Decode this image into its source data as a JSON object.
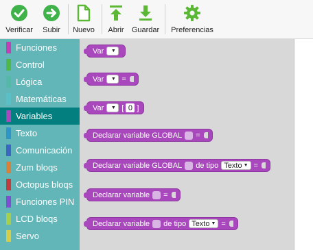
{
  "toolbar": {
    "verify": {
      "label": "Verificar",
      "color": "#3fb24a"
    },
    "upload": {
      "label": "Subir",
      "color": "#3fb24a"
    },
    "new_file": {
      "label": "Nuevo",
      "color": "#5bb834"
    },
    "open": {
      "label": "Abrir",
      "color": "#5bb834"
    },
    "save": {
      "label": "Guardar",
      "color": "#5bb834"
    },
    "prefs": {
      "label": "Preferencias",
      "color": "#5bb834"
    }
  },
  "sidebar": {
    "background": "#63b6b8",
    "selected_background": "#047f7f",
    "categories": [
      {
        "label": "Funciones",
        "color": "#c33fb6"
      },
      {
        "label": "Control",
        "color": "#4fb848"
      },
      {
        "label": "Lógica",
        "color": "#55b9a8"
      },
      {
        "label": "Matemáticas",
        "color": "#58c1c7"
      },
      {
        "label": "Variables",
        "color": "#a848bc",
        "selected": true
      },
      {
        "label": "Texto",
        "color": "#2f94c9"
      },
      {
        "label": "Comunicación",
        "color": "#3b67c2"
      },
      {
        "label": "Zum bloqs",
        "color": "#d7813b"
      },
      {
        "label": "Octopus bloqs",
        "color": "#c43b3b"
      },
      {
        "label": "Funciones PIN",
        "color": "#7f4fd1"
      },
      {
        "label": "LCD bloqs",
        "color": "#a6ce4a"
      },
      {
        "label": "Servo",
        "color": "#d6cc45"
      }
    ]
  },
  "blocks": {
    "b1": {
      "label": "Var"
    },
    "b2": {
      "label": "Var",
      "eq": "="
    },
    "b3": {
      "label": "Var",
      "open_bracket": "[",
      "index": "0",
      "close_bracket": "]"
    },
    "b4": {
      "label": "Declarar variable GLOBAL",
      "eq": "="
    },
    "b5": {
      "label": "Declarar variable GLOBAL",
      "type_label": "de tipo",
      "type_value": "Texto",
      "eq": "="
    },
    "b6": {
      "label": "Declarar variable",
      "eq": "="
    },
    "b7": {
      "label": "Declarar variable",
      "type_label": "de tipo",
      "type_value": "Texto",
      "eq": "="
    }
  },
  "icons": {
    "verify": "check-circle-icon",
    "upload": "arrow-right-circle-icon",
    "new_file": "new-document-icon",
    "open": "upload-arrow-icon",
    "save": "download-arrow-icon",
    "prefs": "gear-icon",
    "dropdown": "caret-down-icon"
  }
}
